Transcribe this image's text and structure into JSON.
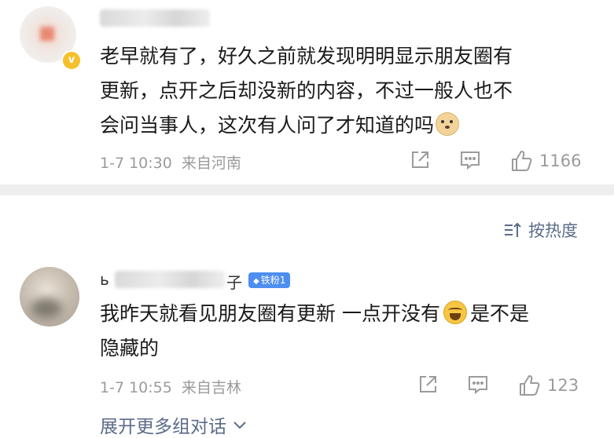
{
  "comments": [
    {
      "username_visible_prefix": "",
      "username_visible_suffix": "",
      "verified": true,
      "text_lines": [
        "老早就有了，好久之前就发现明明显示朋友圈有",
        "更新，点开之后却没新的内容，不过一般人也不",
        "会问当事人，这次有人问了才知道的吗"
      ],
      "emoji": "doge-emoji",
      "time": "1-7 10:30",
      "location": "来自河南",
      "likes": "1166"
    },
    {
      "username_visible_prefix": "ь",
      "username_visible_suffix": "子",
      "fan_badge": "铁粉1",
      "text_line1_a": "我昨天就看见朋友圈有更新 一点开没有",
      "text_line1_b": "是不是",
      "text_line2": "隐藏的",
      "emoji": "crying-laughing-emoji",
      "time": "1-7 10:55",
      "location": "来自吉林",
      "likes": "123"
    }
  ],
  "sort": {
    "label": "按热度",
    "icon": "sort-icon"
  },
  "expand": {
    "label": "展开更多组对话",
    "icon": "chevron-down-icon"
  },
  "icons": {
    "share": "share-icon",
    "comment": "comment-icon",
    "like": "thumbs-up-icon",
    "verified": "verified-badge-icon"
  },
  "colors": {
    "link": "#5b6b89",
    "meta": "#9b9b9b",
    "divider": "#eeeeee",
    "verified": "#f5c02a",
    "fan_badge": "#4d8ef0"
  }
}
